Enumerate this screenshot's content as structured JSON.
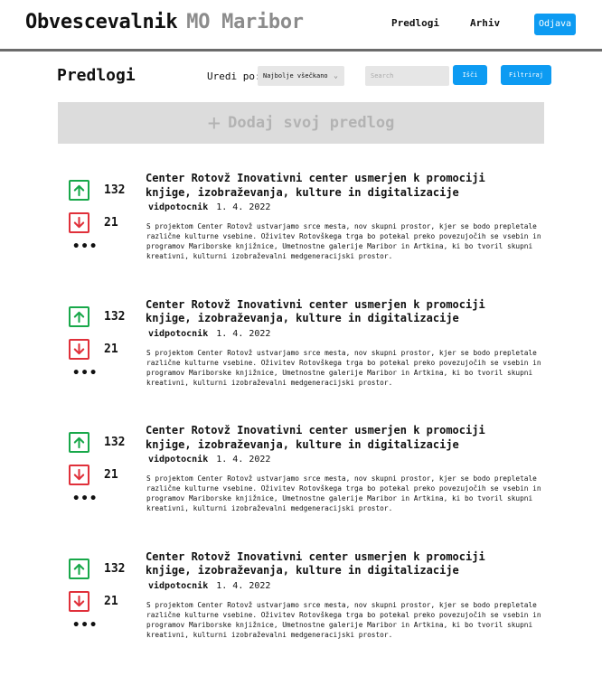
{
  "header": {
    "brand": "Obvescevalnik",
    "brand_sub": "MO Maribor",
    "nav": {
      "proposals": "Predlogi",
      "archive": "Arhiv"
    },
    "logout": "Odjava"
  },
  "toolbar": {
    "title": "Predlogi",
    "sort_label": "Uredi po:",
    "sort_value": "Najbolje všečkano",
    "search_placeholder": "Search",
    "search_button": "Išči",
    "filter_button": "Filtriraj"
  },
  "add": {
    "label": "Dodaj svoj predlog"
  },
  "posts": [
    {
      "upvotes": "132",
      "downvotes": "21",
      "title": "Center Rotovž Inovativni center usmerjen k promociji knjige, izobraževanja, kulture in digitalizacije",
      "author": "vidpotocnik",
      "date": "1. 4. 2022",
      "body": "S projektom Center Rotovž ustvarjamo srce mesta, nov skupni prostor, kjer se bodo prepletale različne kulturne vsebine. Oživitev Rotovškega trga bo potekal preko povezujočih se vsebin in programov Mariborske knjižnice, Umetnostne galerije Maribor in Artkina, ki bo tvoril skupni kreativni, kulturni izobraževalni medgeneracijski prostor."
    },
    {
      "upvotes": "132",
      "downvotes": "21",
      "title": "Center Rotovž Inovativni center usmerjen k promociji knjige, izobraževanja, kulture in digitalizacije",
      "author": "vidpotocnik",
      "date": "1. 4. 2022",
      "body": "S projektom Center Rotovž ustvarjamo srce mesta, nov skupni prostor, kjer se bodo prepletale različne kulturne vsebine. Oživitev Rotovškega trga bo potekal preko povezujočih se vsebin in programov Mariborske knjižnice, Umetnostne galerije Maribor in Artkina, ki bo tvoril skupni kreativni, kulturni izobraževalni medgeneracijski prostor."
    },
    {
      "upvotes": "132",
      "downvotes": "21",
      "title": "Center Rotovž Inovativni center usmerjen k promociji knjige, izobraževanja, kulture in digitalizacije",
      "author": "vidpotocnik",
      "date": "1. 4. 2022",
      "body": "S projektom Center Rotovž ustvarjamo srce mesta, nov skupni prostor, kjer se bodo prepletale različne kulturne vsebine. Oživitev Rotovškega trga bo potekal preko povezujočih se vsebin in programov Mariborske knjižnice, Umetnostne galerije Maribor in Artkina, ki bo tvoril skupni kreativni, kulturni izobraževalni medgeneracijski prostor."
    },
    {
      "upvotes": "132",
      "downvotes": "21",
      "title": "Center Rotovž Inovativni center usmerjen k promociji knjige, izobraževanja, kulture in digitalizacije",
      "author": "vidpotocnik",
      "date": "1. 4. 2022",
      "body": "S projektom Center Rotovž ustvarjamo srce mesta, nov skupni prostor, kjer se bodo prepletale različne kulturne vsebine. Oživitev Rotovškega trga bo potekal preko povezujočih se vsebin in programov Mariborske knjižnice, Umetnostne galerije Maribor in Artkina, ki bo tvoril skupni kreativni, kulturni izobraževalni medgeneracijski prostor."
    }
  ],
  "colors": {
    "accent": "#0d9bf2",
    "upvote": "#18a84a",
    "downvote": "#e0303a",
    "add_bar": "#dcdcdc"
  },
  "icons": {
    "upvote": "arrow-up-icon",
    "downvote": "arrow-down-icon",
    "more": "more-dots-icon",
    "add": "plus-icon",
    "dropdown": "chevron-down-icon"
  }
}
